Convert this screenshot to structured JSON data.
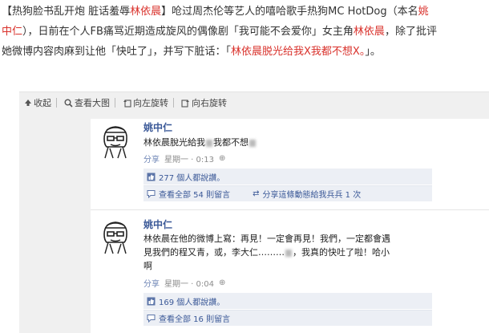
{
  "article": {
    "line1_a": "【热狗脸书乱开炮 脏话羞辱",
    "line1_name": "林依晨",
    "line1_b": "】呛过周杰伦等艺人的嘻哈歌手热狗MC HotDog（本名",
    "line1_real": "姚",
    "line2_real": "中仁",
    "line2_a": "），日前在个人FB痛骂近期造成旋风的偶像剧「我可能不会爱你」女主角",
    "line2_name": "林依晨",
    "line2_b": "，除了批评",
    "line3_a": "她微博内容肉麻到让他「快吐了」，并写下脏话：「",
    "line3_quote": "林依晨脱光给我X我都不想X。",
    "line3_b": "」。"
  },
  "toolbar": {
    "collapse": "收起",
    "view_large": "查看大图",
    "rotate_left": "向左旋转",
    "rotate_right": "向右旋转"
  },
  "posts": [
    {
      "name": "姚中仁",
      "text_a": "林依晨脫光給我",
      "text_b": "我都不想",
      "share": "分享",
      "time": "星期一 · 0:13",
      "likes": "277 個人都說讚。",
      "comments": "查看全部 54 則留言",
      "comment_share": "分享這條動態給我兵兵 1 次"
    },
    {
      "name": "姚中仁",
      "text_1": "林依晨在他的微博上寫：再見！一定會再見！我們，一定都會遇",
      "text_2a": "見我們的程又青，或，李大仁………",
      "text_2b": "，我真的快吐了啦！哈小",
      "text_3": "啊",
      "share": "分享",
      "time": "星期一 · 0:04",
      "likes": "169 個人都說讚。",
      "comments": "查看全部 16 則留言"
    }
  ],
  "colors": {
    "accent_red": "#d9312b",
    "fb_blue": "#3b5998",
    "viewer_bg": "#f0f0f0"
  }
}
